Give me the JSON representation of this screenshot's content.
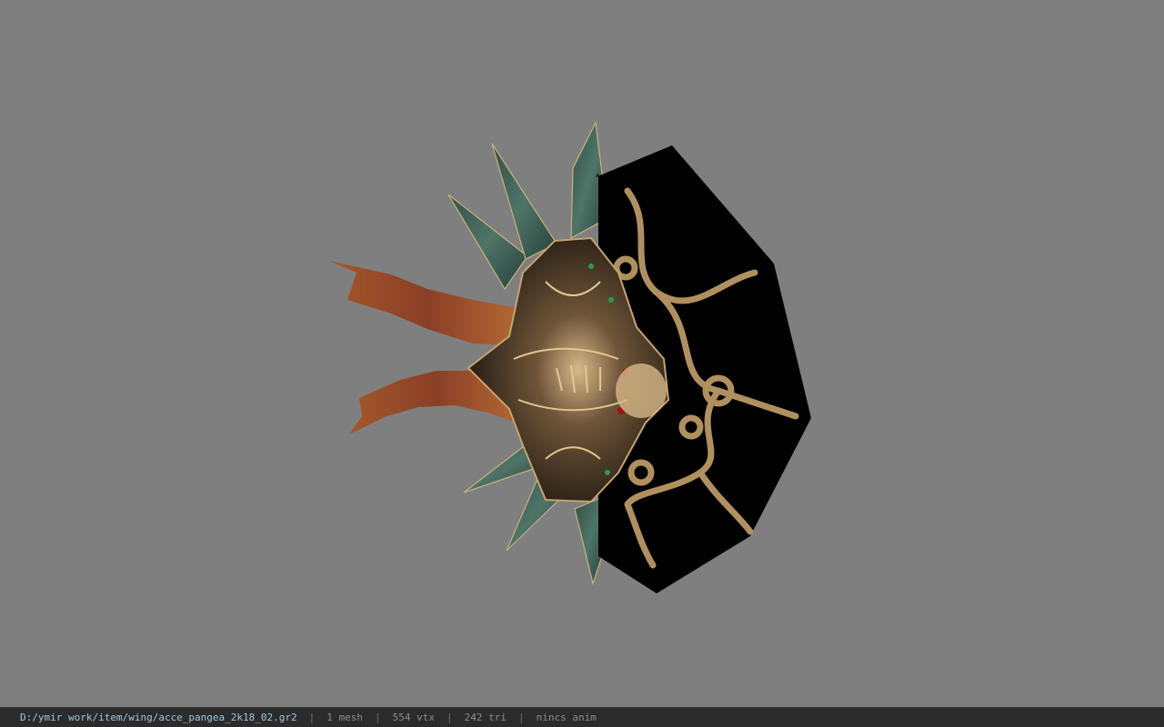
{
  "viewer": {
    "background_color": "#7f7f7f",
    "model_subject": "wing accessory 3D model"
  },
  "statusbar": {
    "path": "D:/ymir work/item/wing/acce_pangea_2k18_02.gr2",
    "meshes": "1 mesh",
    "vertices": "554 vtx",
    "triangles": "242 tri",
    "animation": "nincs anim",
    "separator": "|"
  }
}
